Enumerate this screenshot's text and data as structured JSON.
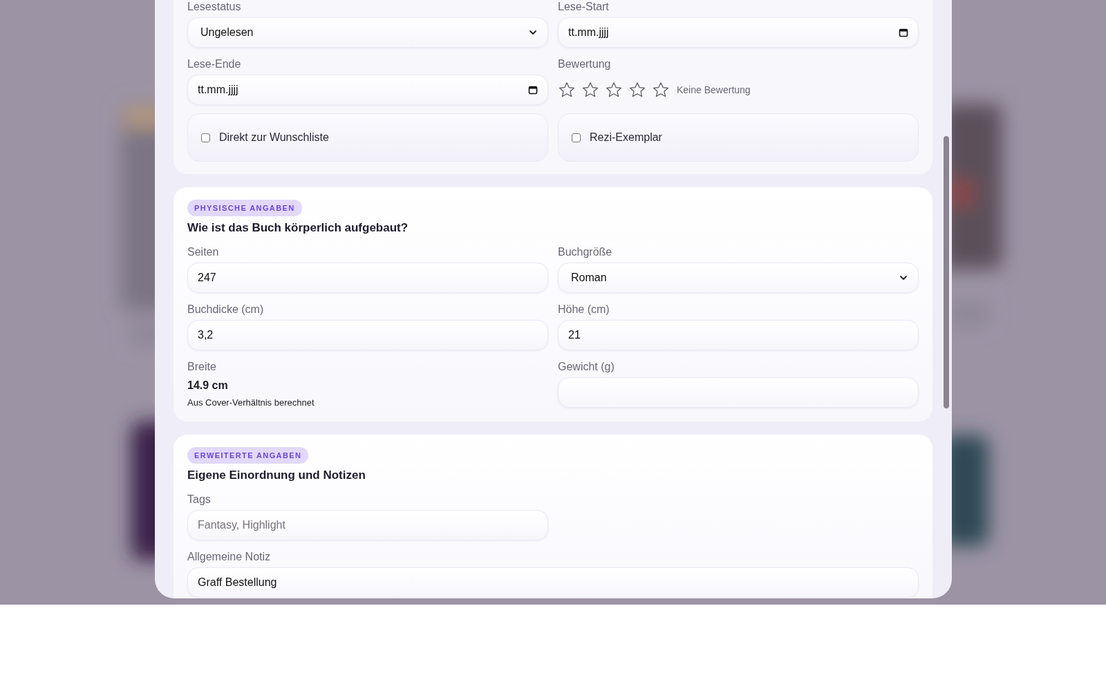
{
  "reading": {
    "fields": [
      {
        "kind": "select",
        "label": "Lesestatus",
        "value": "Ungelesen"
      },
      {
        "kind": "date",
        "label": "Lese-Start",
        "value": "tt.mm.jjjj"
      },
      {
        "kind": "date",
        "label": "Lese-Ende",
        "value": "tt.mm.jjjj"
      },
      {
        "kind": "rating",
        "label": "Bewertung",
        "stars": 0,
        "caption": "Keine Bewertung"
      }
    ],
    "checkboxes": [
      {
        "label": "Direkt zur Wunschliste",
        "checked": false
      },
      {
        "label": "Rezi-Exemplar",
        "checked": false
      }
    ]
  },
  "sections": [
    {
      "badge": "PHYSISCHE ANGABEN",
      "title": "Wie ist das Buch körperlich aufgebaut?",
      "fields": [
        {
          "kind": "text",
          "label": "Seiten",
          "value": "247"
        },
        {
          "kind": "select",
          "label": "Buchgröße",
          "value": "Roman"
        },
        {
          "kind": "text",
          "label": "Buchdicke (cm)",
          "value": "3,2"
        },
        {
          "kind": "text",
          "label": "Höhe (cm)",
          "value": "21"
        },
        {
          "kind": "computed",
          "label": "Breite",
          "value": "14.9 cm",
          "note": "Aus Cover-Verhältnis berechnet"
        },
        {
          "kind": "text",
          "label": "Gewicht (g)"
        }
      ]
    },
    {
      "badge": "ERWEITERTE ANGABEN",
      "title": "Eigene Einordnung und Notizen",
      "fields": [
        {
          "kind": "text",
          "label": "Tags",
          "placeholder": "Fantasy, Highlight"
        },
        {
          "kind": "spacer"
        },
        {
          "kind": "note",
          "label": "Allgemeine Notiz",
          "value": "Graff Bestellung"
        }
      ]
    }
  ]
}
